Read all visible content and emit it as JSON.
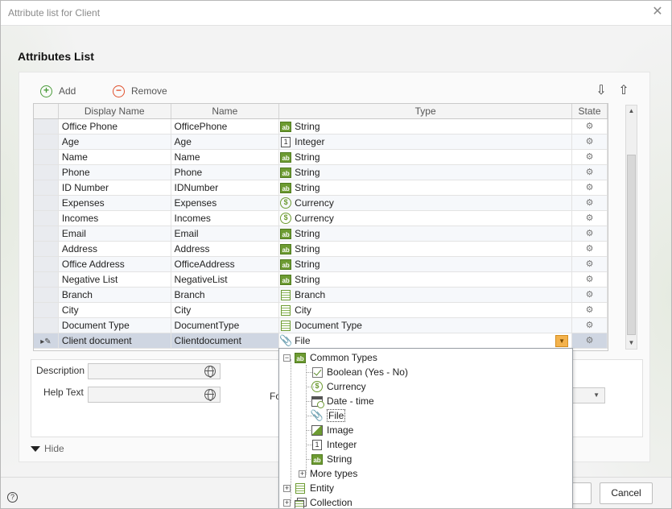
{
  "window": {
    "title": "Attribute list for Client"
  },
  "section": {
    "title": "Attributes List"
  },
  "toolbar": {
    "add_label": "Add",
    "remove_label": "Remove"
  },
  "grid": {
    "columns": [
      "Display Name",
      "Name",
      "Type",
      "State"
    ],
    "rows": [
      {
        "display": "Office Phone",
        "name": "OfficePhone",
        "type": "String",
        "icon": "string-icon"
      },
      {
        "display": "Age",
        "name": "Age",
        "type": "Integer",
        "icon": "integer-icon"
      },
      {
        "display": "Name",
        "name": "Name",
        "type": "String",
        "icon": "string-icon"
      },
      {
        "display": "Phone",
        "name": "Phone",
        "type": "String",
        "icon": "string-icon"
      },
      {
        "display": "ID Number",
        "name": "IDNumber",
        "type": "String",
        "icon": "string-icon"
      },
      {
        "display": "Expenses",
        "name": "Expenses",
        "type": "Currency",
        "icon": "currency-icon"
      },
      {
        "display": "Incomes",
        "name": "Incomes",
        "type": "Currency",
        "icon": "currency-icon"
      },
      {
        "display": "Email",
        "name": "Email",
        "type": "String",
        "icon": "string-icon"
      },
      {
        "display": "Address",
        "name": "Address",
        "type": "String",
        "icon": "string-icon"
      },
      {
        "display": "Office Address",
        "name": "OfficeAddress",
        "type": "String",
        "icon": "string-icon"
      },
      {
        "display": "Negative List",
        "name": "NegativeList",
        "type": "String",
        "icon": "string-icon"
      },
      {
        "display": "Branch",
        "name": "Branch",
        "type": "Branch",
        "icon": "entity-icon"
      },
      {
        "display": "City",
        "name": "City",
        "type": "City",
        "icon": "entity-icon"
      },
      {
        "display": "Document Type",
        "name": "DocumentType",
        "type": "Document Type",
        "icon": "entity-icon"
      },
      {
        "display": "Client document",
        "name": "Clientdocument",
        "type": "File",
        "icon": "file-icon"
      }
    ]
  },
  "details": {
    "description_label": "Description",
    "helptext_label": "Help Text",
    "format_label": "Fo"
  },
  "hide_label": "Hide",
  "buttons": {
    "cancel_label": "Cancel",
    "help_glyph": "?"
  },
  "type_dropdown": {
    "common_types_label": "Common Types",
    "items": [
      {
        "label": "Boolean (Yes - No)",
        "icon": "boolean-icon"
      },
      {
        "label": "Currency",
        "icon": "currency-icon"
      },
      {
        "label": "Date - time",
        "icon": "date-time-icon"
      },
      {
        "label": "File",
        "icon": "file-icon"
      },
      {
        "label": "Image",
        "icon": "image-icon"
      },
      {
        "label": "Integer",
        "icon": "integer-icon"
      },
      {
        "label": "String",
        "icon": "string-icon"
      }
    ],
    "more_types_label": "More types",
    "entity_label": "Entity",
    "collection_label": "Collection"
  },
  "colors": {
    "accent_green": "#6d9b32",
    "dropdown_arrow": "#f3b24c",
    "selected_row": "#cfd6e2"
  }
}
